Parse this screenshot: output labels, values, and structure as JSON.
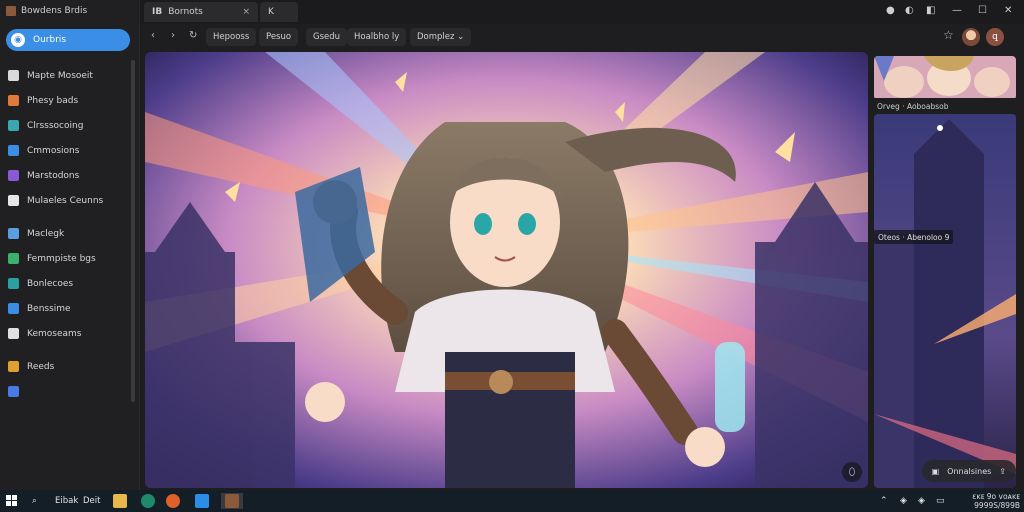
{
  "sidebar": {
    "app_title": "Bowdens Brdis",
    "primary_button": "Ourbris",
    "items": [
      {
        "label": "Mapte Mosoeit",
        "icon": "folder-icon",
        "color": "#d9d9d9"
      },
      {
        "label": "Phesy bads",
        "icon": "tag-icon",
        "color": "#e07a3a"
      },
      {
        "label": "Clrsssocoing",
        "icon": "calendar-icon",
        "color": "#3aa6b0"
      },
      {
        "label": "Cmmosions",
        "icon": "globe-icon",
        "color": "#3a8ee6"
      },
      {
        "label": "Marstodons",
        "icon": "grid-icon",
        "color": "#8a5ad6"
      },
      {
        "label": "Mulaeles Ceunns",
        "icon": "file-icon",
        "color": "#e6e6e6"
      },
      {
        "label": "Maclegk",
        "icon": "mail-icon",
        "color": "#5aa0e0"
      },
      {
        "label": "Femmpiste bgs",
        "icon": "chart-icon",
        "color": "#3ab06a"
      },
      {
        "label": "Bonlecoes",
        "icon": "cloud-icon",
        "color": "#2aa0a0"
      },
      {
        "label": "Benssime",
        "icon": "users-icon",
        "color": "#3a8ee6"
      },
      {
        "label": "Kemoseams",
        "icon": "puzzle-icon",
        "color": "#e0e0e0"
      },
      {
        "label": "Reeds",
        "icon": "star-icon",
        "color": "#e0a030"
      },
      {
        "label": "",
        "icon": "heart-icon",
        "color": "#4a7ae6"
      }
    ]
  },
  "tabs": [
    {
      "label": "Bornots",
      "prefix": "IB",
      "close": "×"
    },
    {
      "label": "K",
      "prefix": "",
      "close": ""
    }
  ],
  "window_controls": {
    "minimize": "—",
    "maximize": "☐",
    "close": "✕"
  },
  "toolbar": {
    "back": "‹",
    "forward": "›",
    "refresh": "↻",
    "chips": [
      "Hepooss",
      "Pesuo",
      "Gsedu",
      "Hoalbho ly",
      "Domplez ⌄"
    ],
    "bookmark": "☆"
  },
  "thumbnails": [
    {
      "caption": "Orveg  ·  Aoboabsob"
    },
    {
      "caption": "Oteos  ·  Abenoloo 9"
    }
  ],
  "bottom_pill": {
    "label": "Onnalsines",
    "icon": "share-icon"
  },
  "taskbar": {
    "search_label": "Eibak",
    "search_label2": "Deit",
    "tray_top": "ɛᴋᴇ 9ᴏ ᴠᴏᴀᴋᴇ",
    "tray_bottom": "9999S/899B"
  }
}
